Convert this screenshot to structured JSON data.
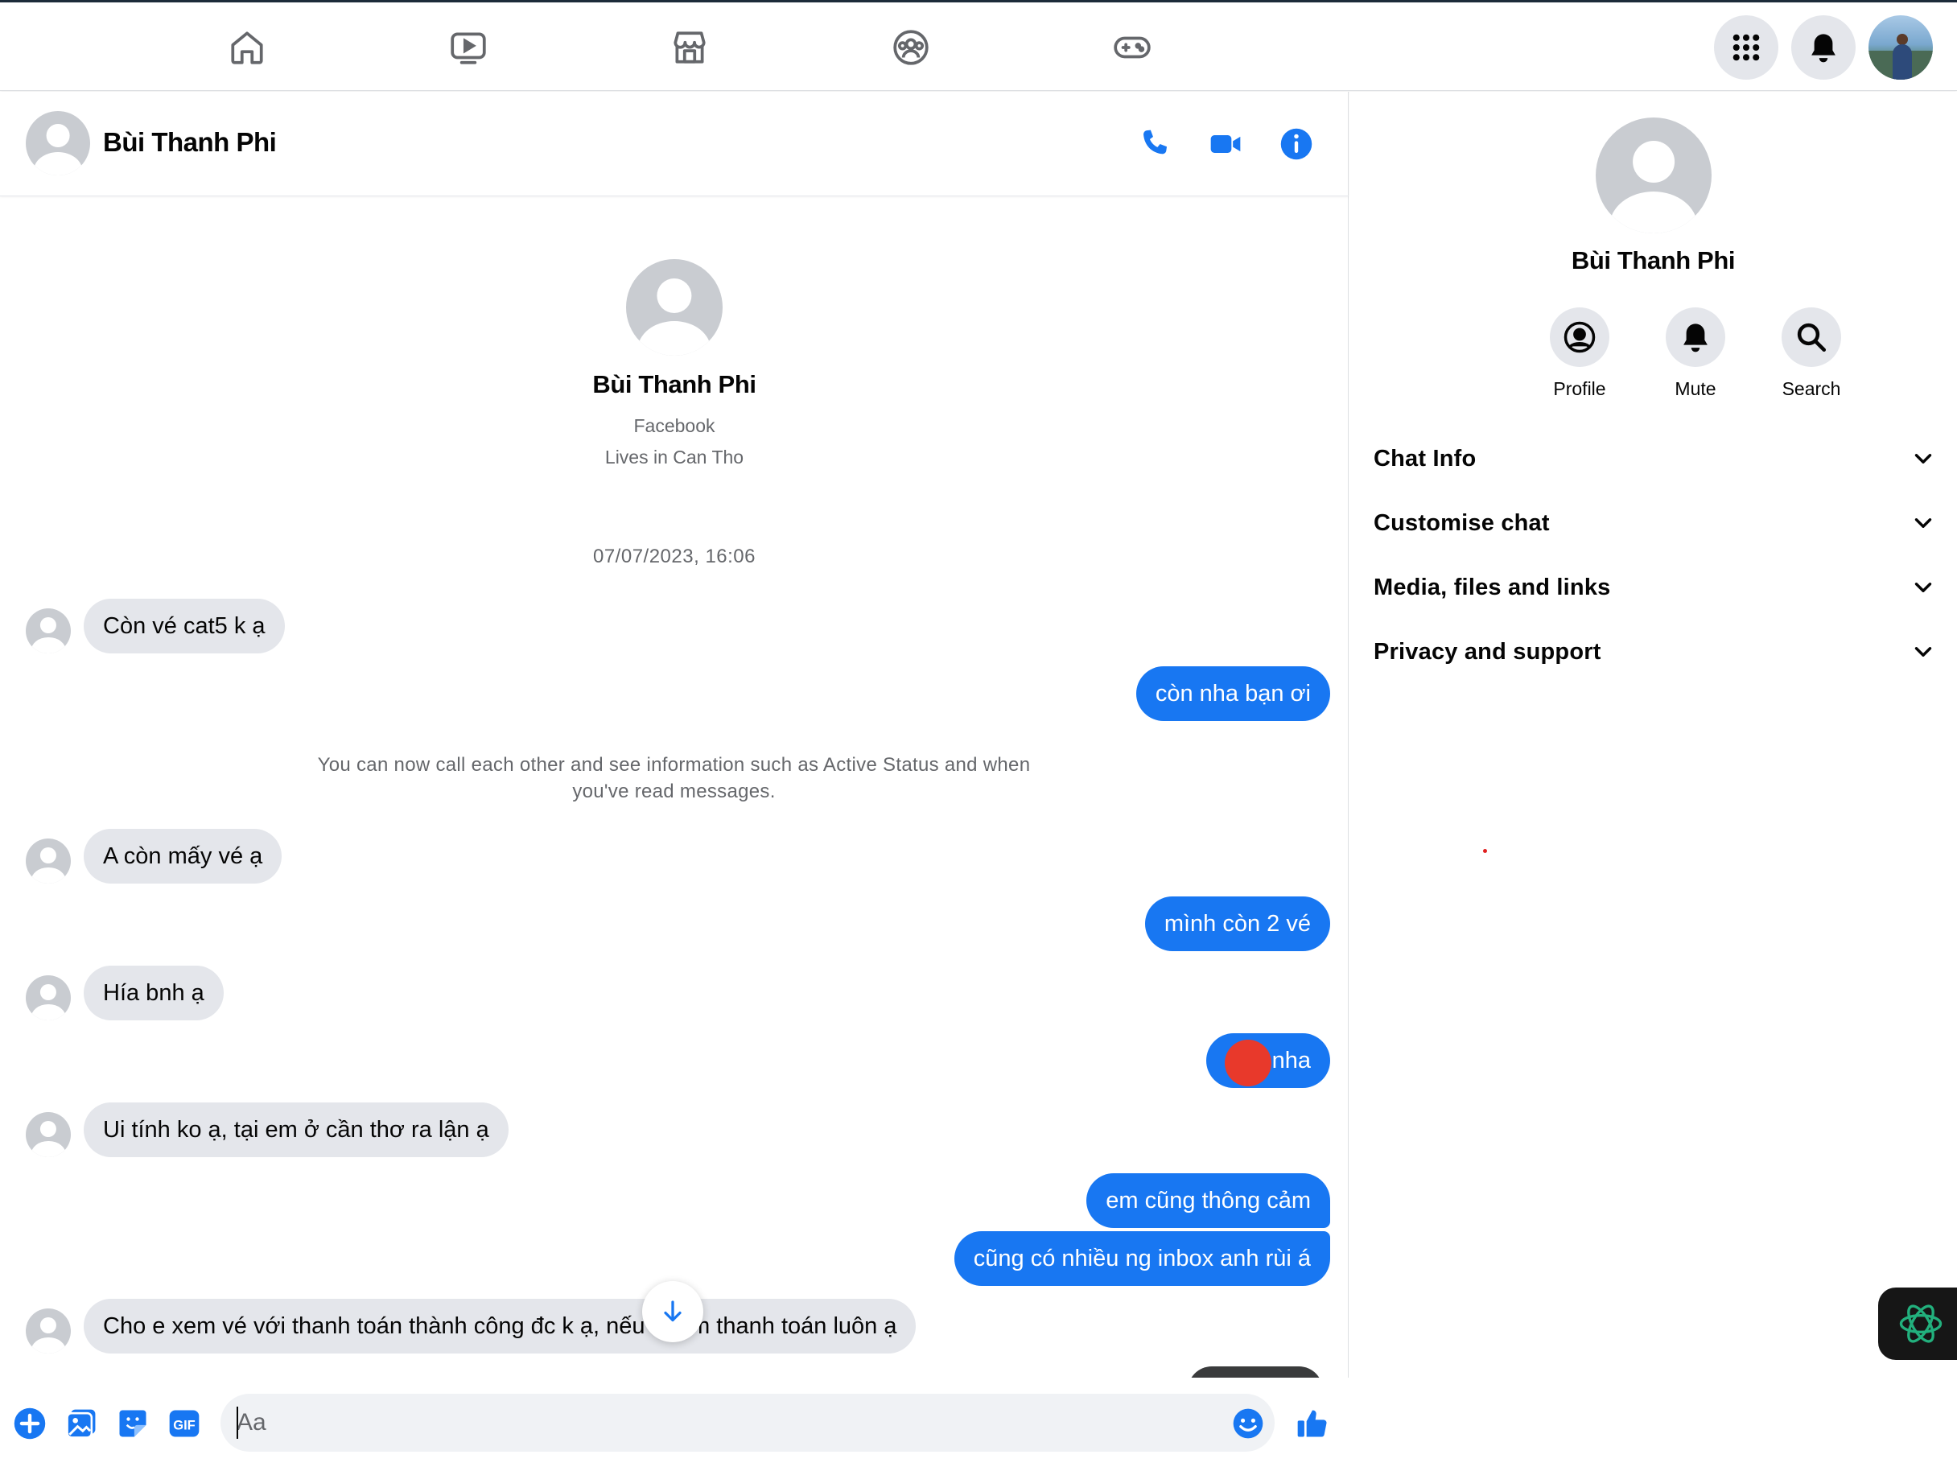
{
  "topnav": {
    "icons": [
      "home-icon",
      "watch-icon",
      "marketplace-icon",
      "groups-icon",
      "gaming-icon"
    ],
    "right_icons": [
      "menu-grid-icon",
      "notifications-bell-icon",
      "account-avatar"
    ]
  },
  "chat": {
    "contact_name": "Bùi Thanh Phi",
    "header_actions": [
      "phone-call-icon",
      "video-call-icon",
      "info-icon"
    ],
    "intro": {
      "name": "Bùi Thanh Phi",
      "network": "Facebook",
      "location": "Lives in Can Tho"
    },
    "timestamp": "07/07/2023, 16:06",
    "system_note": "You can now call each other and see information such as Active Status and when you've read messages.",
    "messages": [
      {
        "dir": "in",
        "text": "Còn vé cat5 k ạ"
      },
      {
        "dir": "out",
        "text": "còn nha bạn ơi"
      },
      {
        "dir": "in",
        "text": "A còn mấy vé ạ"
      },
      {
        "dir": "out",
        "text": "mình còn 2 vé"
      },
      {
        "dir": "in",
        "text": "Hía bnh ạ"
      },
      {
        "dir": "out",
        "text": "nha",
        "redacted_prefix": true
      },
      {
        "dir": "in",
        "text": "Ui tính ko ạ, tại em ở cần thơ ra lận ạ"
      },
      {
        "dir": "out",
        "text": "em cũng thông cảm"
      },
      {
        "dir": "out",
        "text": "cũng có nhiều ng inbox anh rùi á"
      },
      {
        "dir": "in",
        "text": "Cho e xem vé với thanh toán thành công đc k ạ, nếu ✓ em thanh toán luôn ạ"
      }
    ],
    "composer": {
      "placeholder": "Aa",
      "icons": [
        "add-circle-icon",
        "photo-icon",
        "sticker-icon",
        "gif-icon",
        "emoji-icon",
        "thumbs-up-icon"
      ],
      "gif_label": "GIF"
    },
    "accent_color": "#1877f2"
  },
  "info_panel": {
    "name": "Bùi Thanh Phi",
    "actions": [
      {
        "label": "Profile",
        "icon": "profile-icon"
      },
      {
        "label": "Mute",
        "icon": "bell-icon"
      },
      {
        "label": "Search",
        "icon": "search-icon"
      }
    ],
    "sections": [
      "Chat Info",
      "Customise chat",
      "Media, files and links",
      "Privacy and support"
    ]
  }
}
